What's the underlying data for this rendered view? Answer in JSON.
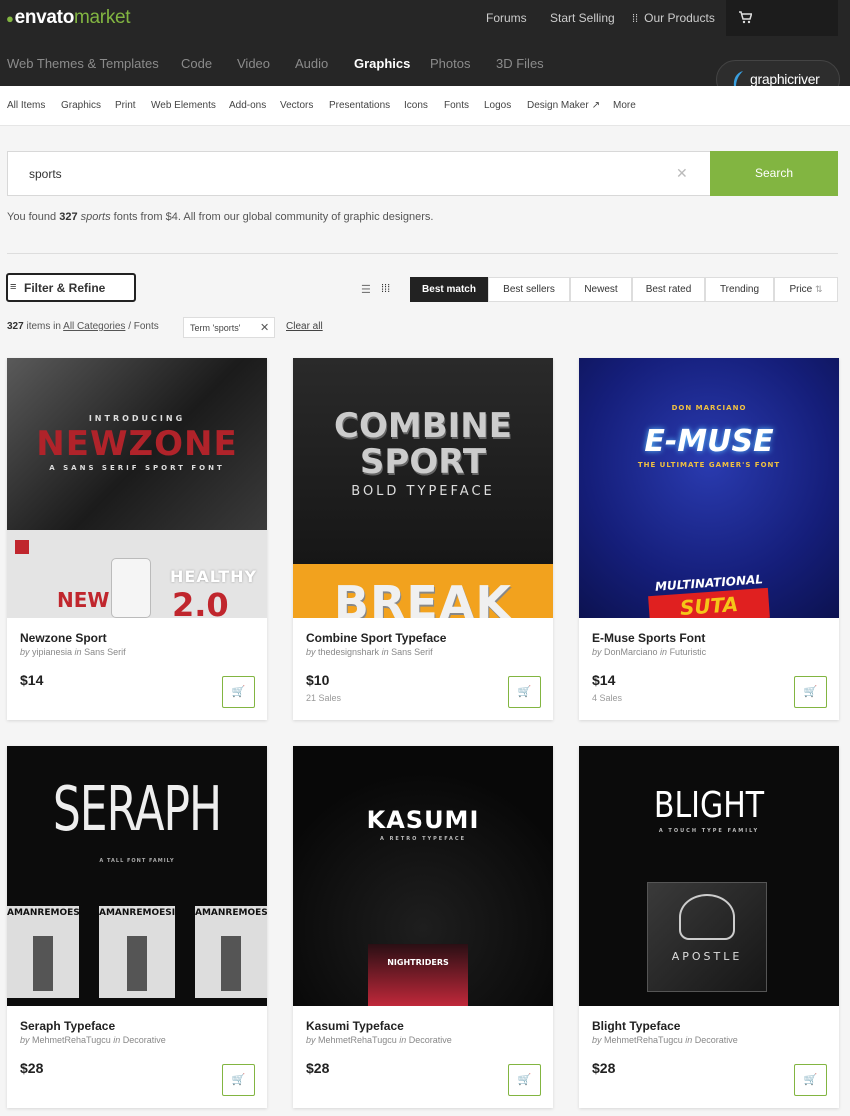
{
  "header": {
    "logo_main": "envato",
    "logo_sub": "market",
    "links": [
      "Forums",
      "Start Selling",
      "Our Products"
    ],
    "main_nav": [
      "Web Themes & Templates",
      "Code",
      "Video",
      "Audio",
      "Graphics",
      "Photos",
      "3D Files"
    ],
    "active_nav": "Graphics",
    "badge": "graphicriver",
    "accent": "#82b541"
  },
  "subnav": [
    "All Items",
    "Graphics",
    "Print",
    "Web Elements",
    "Add-ons",
    "Vectors",
    "Presentations",
    "Icons",
    "Fonts",
    "Logos",
    "Design Maker",
    "More"
  ],
  "search": {
    "value": "sports",
    "button": "Search"
  },
  "results": {
    "prefix": "You found ",
    "count": "327",
    "term": "sports",
    "suffix": " fonts from $4. All from our global community of graphic designers."
  },
  "filters": {
    "filter_label": "Filter & Refine",
    "sort_options": [
      "Best match",
      "Best sellers",
      "Newest",
      "Best rated",
      "Trending",
      "Price"
    ],
    "active_sort": "Best match",
    "items_count": "327",
    "items_label": " items in ",
    "category_link": "All Categories",
    "category_path": " / Fonts",
    "term_tag": "Term 'sports'",
    "clear_all": "Clear all"
  },
  "products": [
    {
      "title": "Newzone Sport",
      "by_prefix": "by ",
      "author": "yipianesia",
      "in": " in ",
      "category": "Sans Serif",
      "price": "$14",
      "sales": "",
      "art": {
        "headline": "NEWZONE",
        "intro": "INTRODUCING",
        "tagline": "A SANS SERIF SPORT FONT",
        "word2": "HEALTHY",
        "word3": "NEW",
        "word4": "2.0"
      }
    },
    {
      "title": "Combine Sport Typeface",
      "by_prefix": "by ",
      "author": "thedesignshark",
      "in": " in ",
      "category": "Sans Serif",
      "price": "$10",
      "sales": "21 Sales",
      "art": {
        "headline": "COMBINE",
        "headline2": "SPORT",
        "tagline": "BOLD TYPEFACE",
        "word2": "BREAK"
      }
    },
    {
      "title": "E-Muse Sports Font",
      "by_prefix": "by ",
      "author": "DonMarciano",
      "in": " in ",
      "category": "Futuristic",
      "price": "$14",
      "sales": "4 Sales",
      "art": {
        "headline": "E-MUSE",
        "intro": "DON MARCIANO",
        "tagline": "THE ULTIMATE GAMER'S FONT",
        "word2": "MULTINATIONAL",
        "word3": "SUTA"
      }
    },
    {
      "title": "Seraph Typeface",
      "by_prefix": "by ",
      "author": "MehmetRehaTugcu",
      "in": " in ",
      "category": "Decorative",
      "price": "$28",
      "sales": "",
      "art": {
        "headline": "SERAPH",
        "tagline": "A TALL FONT FAMILY",
        "word2": "AMANREMOESIA"
      }
    },
    {
      "title": "Kasumi Typeface",
      "by_prefix": "by ",
      "author": "MehmetRehaTugcu",
      "in": " in ",
      "category": "Decorative",
      "price": "$28",
      "sales": "",
      "art": {
        "headline": "KASUMI",
        "tagline": "A RETRO TYPEFACE",
        "word2": "NIGHTRIDERS"
      }
    },
    {
      "title": "Blight Typeface",
      "by_prefix": "by ",
      "author": "MehmetRehaTugcu",
      "in": " in ",
      "category": "Decorative",
      "price": "$28",
      "sales": "",
      "art": {
        "headline": "BLIGHT",
        "tagline": "A TOUCH TYPE FAMILY",
        "word2": "APOSTLE"
      }
    }
  ]
}
